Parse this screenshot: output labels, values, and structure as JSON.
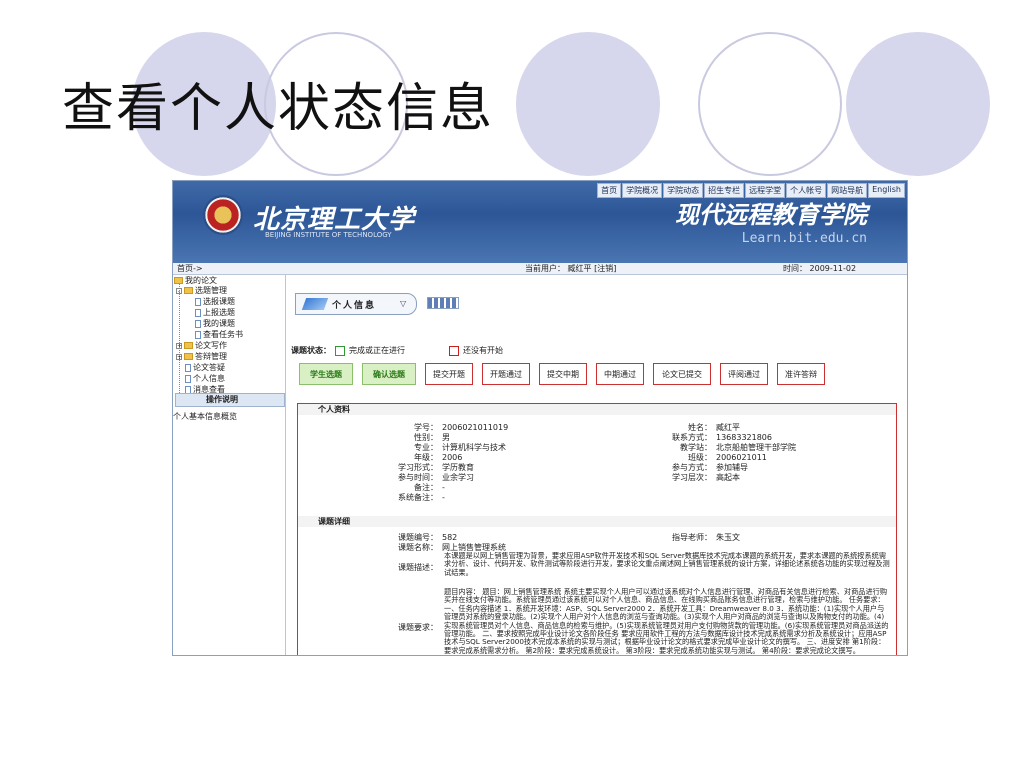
{
  "slide": {
    "title": "查看个人状态信息"
  },
  "header": {
    "top_links": [
      "首页",
      "学院概况",
      "学院动态",
      "招生专栏",
      "远程学堂",
      "个人帐号",
      "网站导航",
      "English"
    ],
    "uni_name": "北京理工大学",
    "uni_en": "BEIJING INSTITUTE OF TECHNOLOGY",
    "school_name": "现代远程教育学院",
    "school_url": "Learn.bit.edu.cn"
  },
  "statusbar": {
    "nav": "首页->",
    "current_user": "当前用户： 臧红平 [注销]",
    "time": "时间： 2009-11-02"
  },
  "sidebar": {
    "root": "我的论文",
    "items": [
      "选题管理",
      "选报课题",
      "上报选题",
      "我的课题",
      "查看任务书",
      "论文写作",
      "答辩管理",
      "论文答疑",
      "个人信息",
      "消息查看"
    ],
    "op_tab": "操作说明",
    "note": "个人基本信息概览"
  },
  "main": {
    "tab_label": "个人信息",
    "status_label": "课题状态：",
    "legend_done": "完成或正在进行",
    "legend_todo": "还没有开始",
    "steps": [
      "学生选题",
      "确认选题",
      "提交开题",
      "开题通过",
      "提交中期",
      "中期通过",
      "论文已提交",
      "评阅通过",
      "准许答辩"
    ],
    "section_profile": "个人资料",
    "section_topic": "课题详细"
  },
  "profile_left": [
    {
      "k": "学号：",
      "v": "2006021011019"
    },
    {
      "k": "性别：",
      "v": "男"
    },
    {
      "k": "专业：",
      "v": "计算机科学与技术"
    },
    {
      "k": "年级：",
      "v": "2006"
    },
    {
      "k": "学习形式：",
      "v": "学历教育"
    },
    {
      "k": "参与时间：",
      "v": "业余学习"
    },
    {
      "k": "备注：",
      "v": "-"
    },
    {
      "k": "系统备注：",
      "v": "-"
    }
  ],
  "profile_right": [
    {
      "k": "姓名：",
      "v": "臧红平"
    },
    {
      "k": "联系方式：",
      "v": "13683321806"
    },
    {
      "k": "教学站：",
      "v": "北京船舶管理干部学院"
    },
    {
      "k": "班级：",
      "v": "2006021011"
    },
    {
      "k": "参与方式：",
      "v": "参加辅导"
    },
    {
      "k": "学习层次：",
      "v": "高起本"
    }
  ],
  "topic": {
    "number_k": "课题编号：",
    "number_v": "582",
    "advisor_k": "指导老师：",
    "advisor_v": "朱玉文",
    "name_k": "课题名称：",
    "name_v": "网上销售管理系统",
    "desc_k": "课题描述：",
    "desc_v": "本课题是以网上销售管理为背景，要求应用ASP软件开发技术和SQL Server数据库技术完成本课题的系统开发，要求本课题的系统按系统需求分析、设计、代码开发、软件测试等阶段进行开发，要求论文重点阐述网上销售管理系统的设计方案，详细论述系统各功能的实现过程及测试结果。",
    "req_k": "课题要求：",
    "req_v": "题目内容： 题目：网上销售管理系统 系统主要实现个人用户可以通过该系统对个人信息进行管理、对商品有关信息进行检索、对商品进行购买并在线支付等功能。系统管理员通过该系统可以对个人信息、商品信息、在线购买商品账务信息进行管理，检索与维护功能。 任务要求： 一、任务内容描述 1．系统开发环境：ASP、SQL Server2000 2．系统开发工具：Dreamweaver 8.0 3．系统功能：(1)实现个人用户与管理员对系统的登录功能。(2)实现个人用户对个人信息的浏览与查询功能。(3)实现个人用户对商品的浏览与查询以及购物支付的功能。(4)实现系统管理员对个人信息、商品信息的检索与维护。(5)实现系统管理员对用户支付购物货款的管理功能。(6)实现系统管理员对商品派送的管理功能。 二、要求按照完成毕业设计论文各阶段任务 要求应用软件工程的方法与数据库设计技术完成系统需求分析及系统设计；应用ASP技术与SQL Server2000技术完成本系统的实现与测试；根据毕业设计论文的格式要求完成毕业设计论文的撰写。 三、进度安排 第1阶段：要求完成系统需求分析。 第2阶段：要求完成系统设计。 第3阶段：要求完成系统功能实现与测试。 第4阶段：要求完成论文撰写。"
  },
  "colors": {
    "header_blue": "#2d5697",
    "panel_red": "#cc3030",
    "done_green": "#d9efc4",
    "circle": "#d6d6ec"
  }
}
